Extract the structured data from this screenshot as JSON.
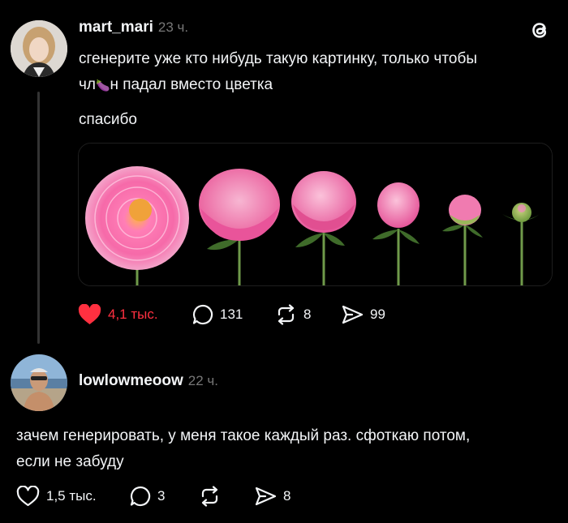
{
  "post1": {
    "username": "mart_mari",
    "time": "23 ч.",
    "text_line1": "сгенерите уже кто нибудь такую картинку, только чтобы",
    "text_line2_a": "чл",
    "text_line2_emoji": "🍆",
    "text_line2_b": "н падал вместо цветка",
    "text_line3": "спасибо",
    "image_description": "peony flowers from full bloom to bud",
    "actions": {
      "likes": "4,1 тыс.",
      "comments": "131",
      "reposts": "8",
      "shares": "99"
    },
    "liked": true,
    "like_color": "#ff3040"
  },
  "post2": {
    "username": "lowlowmeoow",
    "time": "22 ч.",
    "text_line1": "зачем генерировать, у меня такое каждый раз. сфоткаю потом,",
    "text_line2": "если не забуду",
    "actions": {
      "likes": "1,5 тыс.",
      "comments": "3",
      "reposts": "",
      "shares": "8"
    },
    "liked": false
  },
  "icons": {
    "app_logo": "threads-logo-icon",
    "like": "heart-icon",
    "comment": "comment-icon",
    "repost": "repost-icon",
    "share": "send-icon"
  },
  "colors": {
    "background": "#000000",
    "text": "#f3f5f7",
    "muted": "#777777",
    "accent_like": "#ff3040"
  }
}
